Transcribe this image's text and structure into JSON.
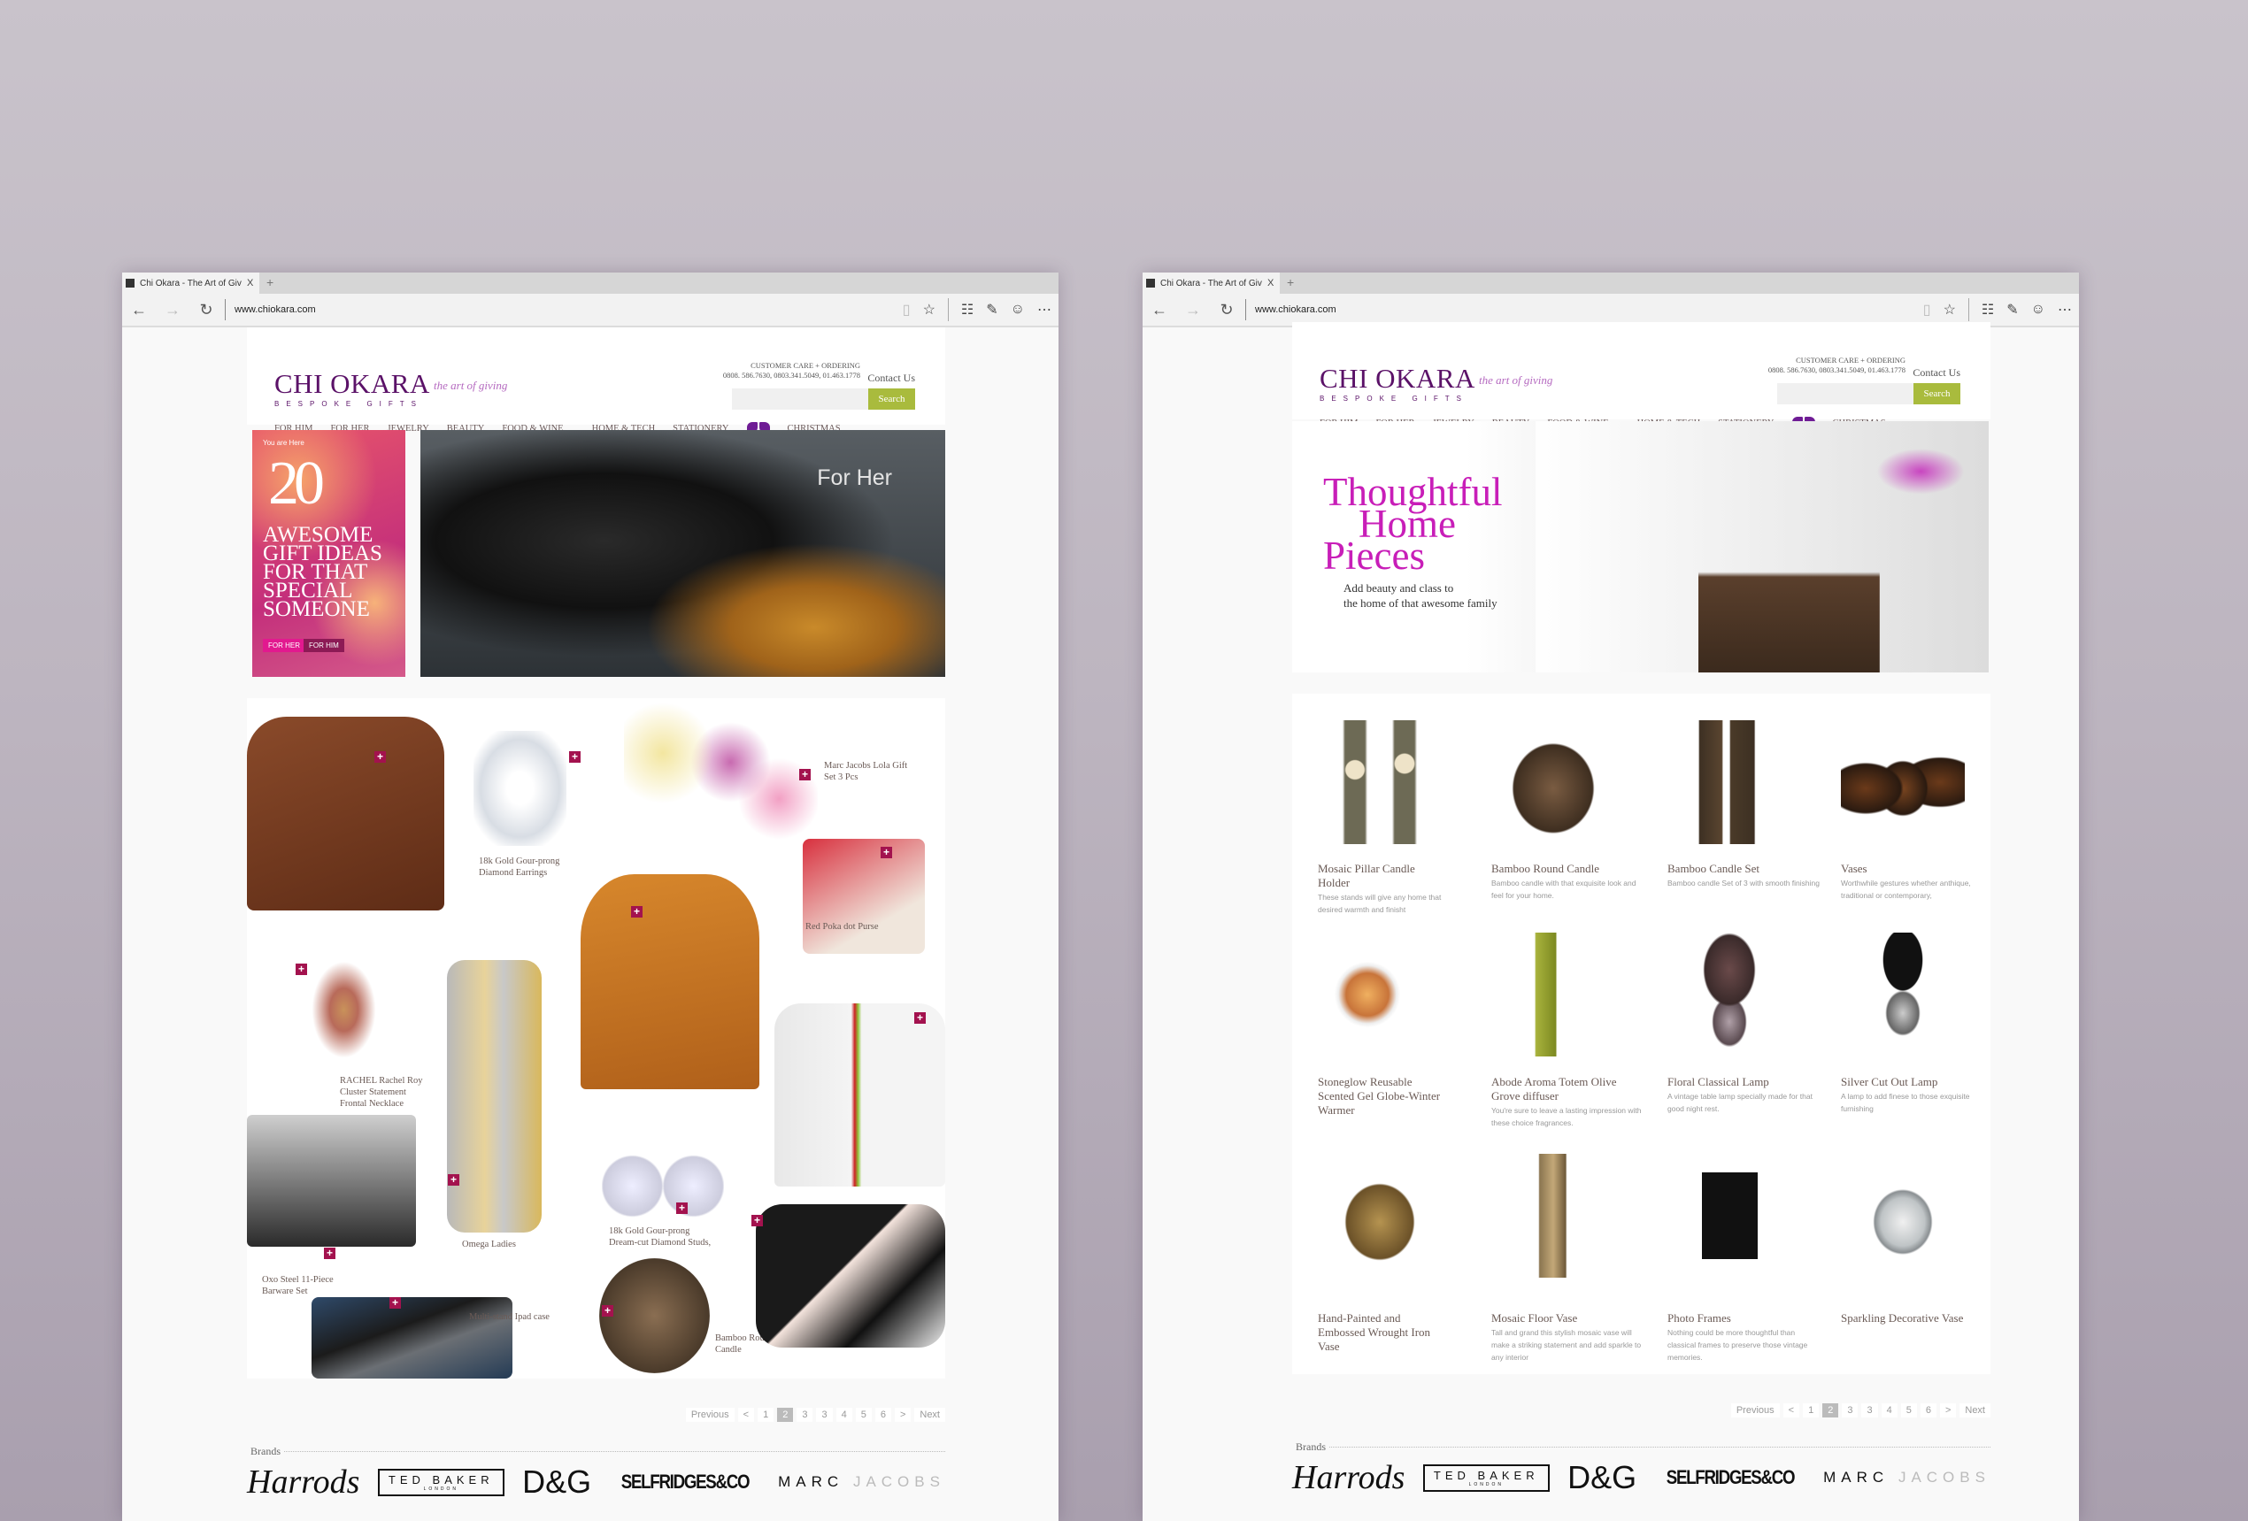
{
  "colors": {
    "brand_purple": "#5b1268",
    "accent_magenta": "#c81eb8",
    "search_green": "#a9bb3d",
    "plus_badge": "#a3124e",
    "pager_active": "#bbbbbb"
  },
  "browser": {
    "tab_title": "Chi Okara - The Art of Giv",
    "tab_close": "X",
    "new_tab": "+",
    "url": "www.chiokara.com",
    "icons": [
      "back-arrow-icon",
      "forward-arrow-icon",
      "refresh-icon",
      "reading-view-icon",
      "favorite-star-icon",
      "hub-icon",
      "web-note-icon",
      "feedback-smiley-icon",
      "more-icon"
    ]
  },
  "site": {
    "logo": "CHI OKARA",
    "tagline": "the art of giving",
    "subtitle": "BESPOKE GIFTS",
    "care_label": "CUSTOMER CARE + ORDERING",
    "care_phones": "0808. 586.7630, 0803.341.5049, 01.463.1778",
    "contact": "Contact Us",
    "search_placeholder": "",
    "search_button": "Search",
    "nav": [
      "FOR HIM",
      "FOR HER",
      "JEWELRY",
      "BEAUTY",
      "FOOD & WINE",
      "HOME & TECH",
      "STATIONERY",
      "CHRISTMAS"
    ],
    "pager": {
      "previous": "Previous",
      "prev_arrow": "<",
      "pages": [
        "1",
        "2",
        "3",
        "3",
        "4",
        "5",
        "6"
      ],
      "current": "2",
      "next_arrow": ">",
      "next": "Next"
    },
    "brands_label": "Brands",
    "brands": [
      "Harrods",
      "TED BAKER",
      "LONDON",
      "D&G",
      "SELFRIDGES&CO",
      "MARC",
      "JACOBS"
    ]
  },
  "left_page": {
    "banner": {
      "you_are_here": "You are Here",
      "number": "20",
      "headline": "AWESOME GIFT IDEAS FOR THAT SPECIAL SOMEONE",
      "btn_her": "FOR HER",
      "btn_him": "FOR HIM"
    },
    "hero_caption": "For Her",
    "collage": [
      {
        "name": "leather-duffel-bag",
        "caption": ""
      },
      {
        "name": "diamond-earrings",
        "caption": "18k Gold Gour-prong Diamond Earrings"
      },
      {
        "name": "perfume-gift-set",
        "caption": "Marc Jacobs Lola Gift Set 3 Pcs"
      },
      {
        "name": "red-purse",
        "caption": "Red Poka dot Purse"
      },
      {
        "name": "necklace",
        "caption": "RACHEL Rachel Roy Cluster Statement Frontal Necklace"
      },
      {
        "name": "orange-tote",
        "caption": ""
      },
      {
        "name": "omega-watch",
        "caption": "Omega Ladies"
      },
      {
        "name": "white-bag",
        "caption": ""
      },
      {
        "name": "barware-set",
        "caption": "Oxo Steel 11-Piece Barware Set"
      },
      {
        "name": "diamond-studs",
        "caption": "18k Gold Gour-prong Dream-cut Diamond Studs,"
      },
      {
        "name": "ipad-case",
        "caption": "Multi-stand Ipad case"
      },
      {
        "name": "bamboo-candle",
        "caption": "Bamboo Round Candle"
      },
      {
        "name": "pouch-scarf",
        "caption": ""
      }
    ]
  },
  "right_page": {
    "hero": {
      "title_lines": [
        "Thoughtful",
        "Home",
        "Pieces"
      ],
      "subtitle_lines": [
        "Add beauty and class to",
        "the home of that awesome family"
      ]
    },
    "products": [
      {
        "title": "Mosaic Pillar Candle Holder",
        "desc": "These stands will give any home that desired warmth and finisht"
      },
      {
        "title": "Bamboo Round Candle",
        "desc": "Bamboo candle with that exquisite look and feel for your home."
      },
      {
        "title": "Bamboo Candle Set",
        "desc": "Bamboo candle Set of 3 with smooth finishing"
      },
      {
        "title": "Vases",
        "desc": "Worthwhile gestures whether anthique, traditional or contemporary,"
      },
      {
        "title": "Stoneglow Reusable Scented Gel Globe-Winter Warmer",
        "desc": ""
      },
      {
        "title": "Abode Aroma Totem Olive Grove diffuser",
        "desc": "You're sure to leave a lasting impression with these choice fragrances."
      },
      {
        "title": "Floral Classical Lamp",
        "desc": "A vintage table lamp specially made for that good night rest."
      },
      {
        "title": "Silver Cut Out Lamp",
        "desc": "A lamp to add finese to those exquisite furnishing"
      },
      {
        "title": "Hand-Painted and Embossed Wrought Iron Vase",
        "desc": ""
      },
      {
        "title": "Mosaic Floor Vase",
        "desc": "Tall and grand this stylish mosaic vase will make a striking statement and add sparkle to any interior"
      },
      {
        "title": "Photo Frames",
        "desc": "Nothing could be more thoughtful than classical frames to preserve those vintage memories."
      },
      {
        "title": "Sparkling Decorative Vase",
        "desc": ""
      }
    ]
  }
}
